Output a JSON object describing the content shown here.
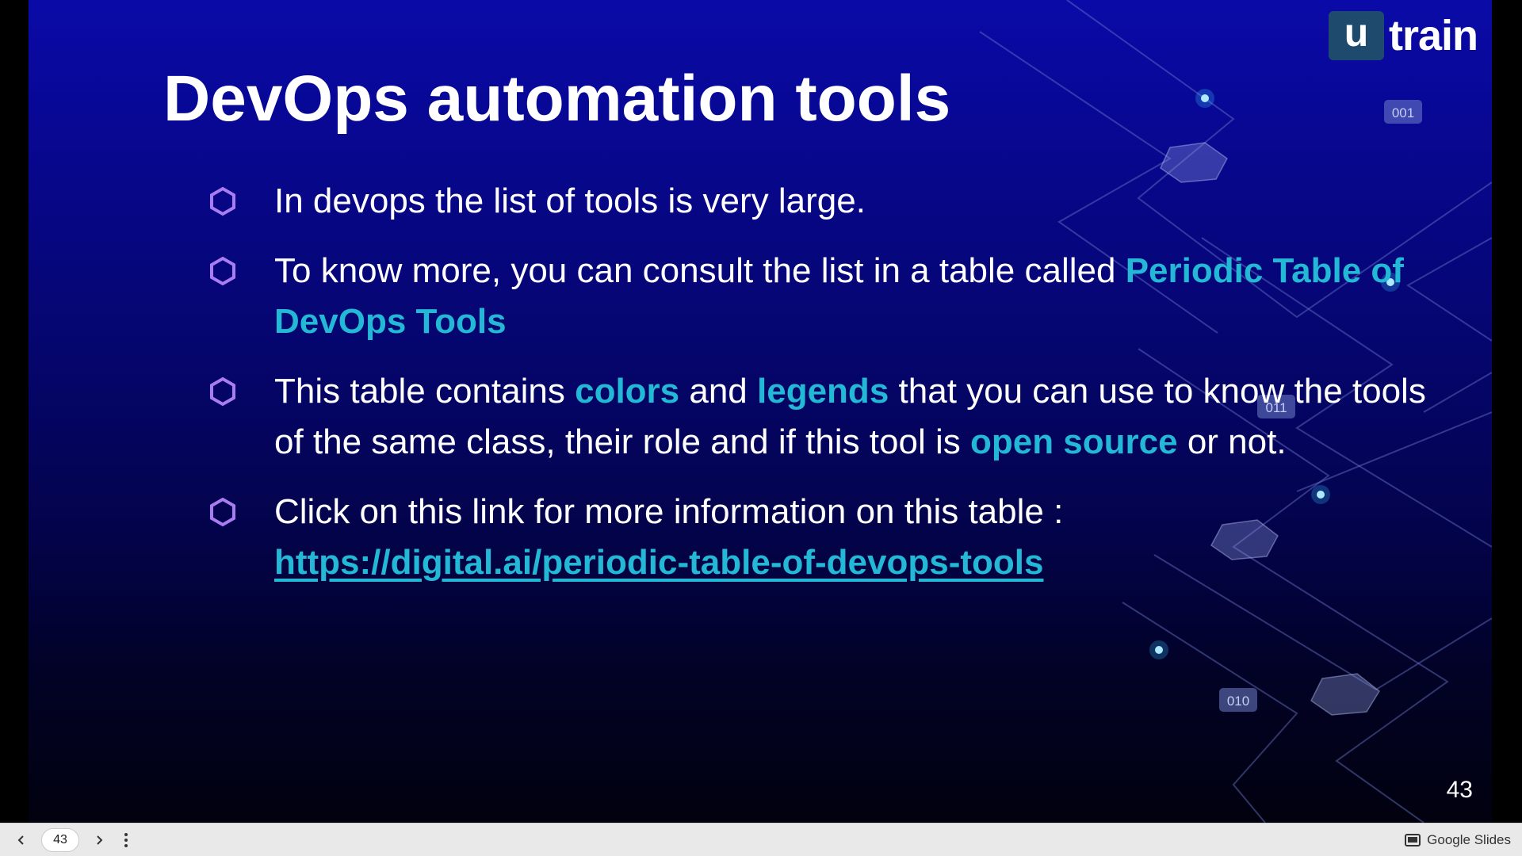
{
  "slide": {
    "title": "DevOps automation tools",
    "logo": {
      "box_letter": "u",
      "text": "train"
    },
    "slide_number": "43",
    "bullets": [
      {
        "segments": [
          {
            "text": "In devops the list of tools is very large.",
            "style": "normal"
          }
        ]
      },
      {
        "segments": [
          {
            "text": "To know more, you can consult the list in a table called ",
            "style": "normal"
          },
          {
            "text": "Periodic Table of DevOps Tools",
            "style": "highlight"
          }
        ]
      },
      {
        "segments": [
          {
            "text": "This table contains ",
            "style": "normal"
          },
          {
            "text": "colors",
            "style": "highlight"
          },
          {
            "text": " and ",
            "style": "normal"
          },
          {
            "text": "legends",
            "style": "highlight"
          },
          {
            "text": " that you can use to know the tools of the same class, their role and if this tool is ",
            "style": "normal"
          },
          {
            "text": "open source",
            "style": "highlight"
          },
          {
            "text": " or not.",
            "style": "normal"
          }
        ]
      },
      {
        "segments": [
          {
            "text": "Click on this link for more information on this table : ",
            "style": "normal"
          },
          {
            "text": "https://digital.ai/periodic-table-of-devops-tools",
            "style": "link"
          }
        ]
      }
    ],
    "decor_labels": [
      "001",
      "011",
      "010"
    ]
  },
  "viewer": {
    "current_page": "43",
    "brand": "Google Slides"
  },
  "colors": {
    "highlight": "#22b8d6",
    "bullet_icon": "#a97cf2",
    "background_top": "#0a0aa8",
    "background_bottom": "#01010f"
  },
  "icons": {
    "bullet": "hexagon-outline-icon",
    "prev": "chevron-left-icon",
    "next": "chevron-right-icon",
    "menu": "more-vertical-icon",
    "brand": "slides-icon"
  }
}
